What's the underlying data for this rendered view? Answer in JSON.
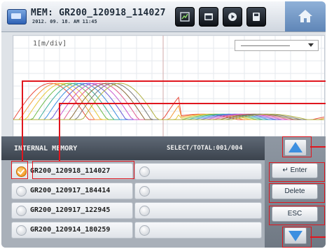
{
  "header": {
    "mem_title": "MEM: GR200_120918_114027",
    "datetime": "2012. 09. 18.  AM 11:45",
    "toolbar_icons": [
      "graph-icon",
      "window-icon",
      "play-icon",
      "save-icon"
    ],
    "home_icon": "home-icon"
  },
  "chart": {
    "unit_label": "1[m/div]"
  },
  "memory": {
    "title": "INTERNAL MEMORY",
    "select_total": "SELECT/TOTAL:001/004",
    "files": [
      {
        "name": "GR200_120918_114027",
        "selected": true
      },
      {
        "name": "GR200_120917_184414",
        "selected": false
      },
      {
        "name": "GR200_120917_122945",
        "selected": false
      },
      {
        "name": "GR200_120914_180259",
        "selected": false
      }
    ]
  },
  "sidebar": {
    "enter": "Enter",
    "delete": "Delete",
    "esc": "ESC"
  },
  "colors": {
    "annotation": "#e0161e",
    "accent": "#3c8fe0",
    "selected": "#f08a10"
  }
}
